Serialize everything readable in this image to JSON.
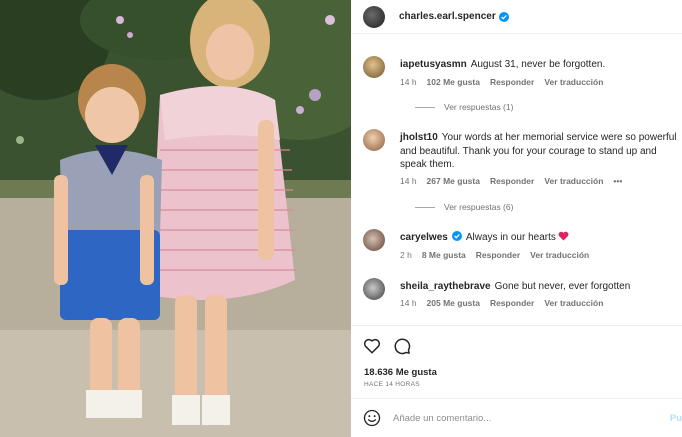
{
  "post": {
    "username": "charles.earl.spencer",
    "verified": true,
    "likes": "18.636 Me gusta",
    "time": "HACE 14 HORAS"
  },
  "comments": [
    {
      "username": "iapetusyasmn",
      "text": "August 31, never be forgotten.",
      "time": "14 h",
      "likes": "102 Me gusta",
      "reply": "Responder",
      "translate": "Ver traducción",
      "replies": "Ver respuestas (1)"
    },
    {
      "username": "jholst10",
      "text": "Your words at her memorial service were so powerful and beautiful. Thank you for your courage to stand up and speak them.",
      "time": "14 h",
      "likes": "267 Me gusta",
      "reply": "Responder",
      "translate": "Ver traducción",
      "more": "•••",
      "replies": "Ver respuestas (6)"
    },
    {
      "username": "caryelwes",
      "verified": true,
      "text": "Always in our hearts",
      "time": "2 h",
      "likes": "8 Me gusta",
      "reply": "Responder",
      "translate": "Ver traducción"
    },
    {
      "username": "sheila_raythebrave",
      "text": "Gone but never, ever forgotten",
      "time": "14 h",
      "likes": "205 Me gusta",
      "reply": "Responder",
      "translate": "Ver traducción"
    }
  ],
  "composer": {
    "placeholder": "Añade un comentario...",
    "post_label": "Pu"
  },
  "icons": {
    "like": "heart-outline-icon",
    "comment": "comment-bubble-icon",
    "emoji": "emoji-smile-icon",
    "verified": "verified-badge-icon",
    "heart_emoji": "red-heart-icon"
  },
  "colors": {
    "verified": "#0095f6",
    "heart": "#e0245e",
    "secondary_text": "#737373"
  }
}
